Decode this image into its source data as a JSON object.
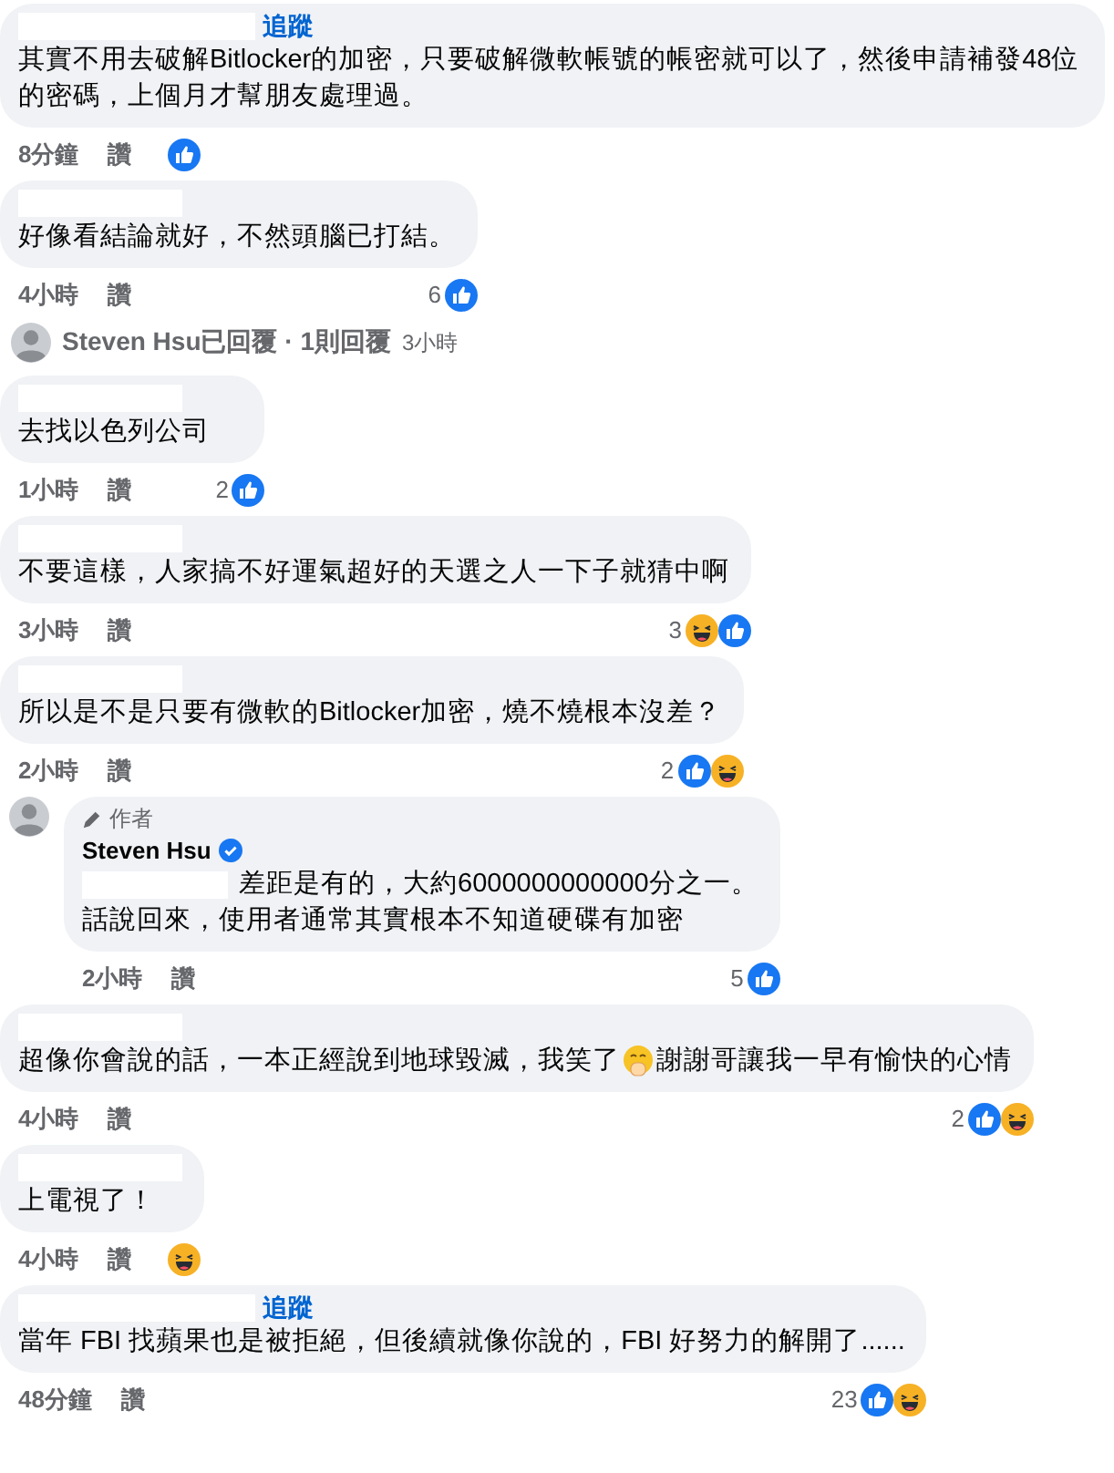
{
  "comments": [
    {
      "kind": "comment",
      "follow": "追蹤",
      "text": [
        "其實不用去破解Bitlocker的加密，只要破解微軟帳號的帳密就可以了，然後申請補發48位的密碼，上個月才幫朋友處理過。"
      ],
      "time": "8分鐘",
      "like_label": "讚",
      "reactions": [
        {
          "kind": "like"
        }
      ]
    },
    {
      "kind": "comment",
      "text": [
        "好像看結論就好，不然頭腦已打結。"
      ],
      "time": "4小時",
      "like_label": "讚",
      "count": "6",
      "reactions": [
        {
          "kind": "like"
        }
      ]
    },
    {
      "kind": "reply_summary",
      "label": "Steven Hsu已回覆 · 1則回覆",
      "time": "3小時"
    },
    {
      "kind": "comment",
      "text": [
        "去找以色列公司"
      ],
      "time": "1小時",
      "like_label": "讚",
      "count": "2",
      "reactions": [
        {
          "kind": "like"
        }
      ]
    },
    {
      "kind": "comment",
      "text": [
        "不要這樣，人家搞不好運氣超好的天選之人一下子就猜中啊"
      ],
      "time": "3小時",
      "like_label": "讚",
      "count": "3",
      "reactions": [
        {
          "kind": "haha"
        },
        {
          "kind": "like"
        }
      ]
    },
    {
      "kind": "comment",
      "text": [
        "所以是不是只要有微軟的Bitlocker加密，燒不燒根本沒差？"
      ],
      "time": "2小時",
      "like_label": "讚",
      "count": "2",
      "reactions": [
        {
          "kind": "like"
        },
        {
          "kind": "haha"
        }
      ]
    },
    {
      "kind": "reply",
      "badge": "作者",
      "name": "Steven Hsu",
      "verified": true,
      "mention": true,
      "text": [
        "差距是有的，大約6000000000000分之一。",
        "話說回來，使用者通常其實根本不知道硬碟有加密"
      ],
      "time": "2小時",
      "like_label": "讚",
      "count": "5",
      "reactions": [
        {
          "kind": "like"
        }
      ]
    },
    {
      "kind": "comment",
      "text": [
        "超像你會說的話，一本正經說到地球毀滅，我笑了",
        "謝謝哥讓我一早有愉快的心情"
      ],
      "inline_emoji": true,
      "time": "4小時",
      "like_label": "讚",
      "count": "2",
      "reactions": [
        {
          "kind": "like"
        },
        {
          "kind": "haha"
        }
      ]
    },
    {
      "kind": "comment",
      "text": [
        "上電視了！"
      ],
      "time": "4小時",
      "like_label": "讚",
      "reactions": [
        {
          "kind": "haha"
        }
      ]
    },
    {
      "kind": "comment",
      "follow": "追蹤",
      "text": [
        "當年 FBI 找蘋果也是被拒絕，但後續就像你說的，FBI 好努力的解開了......"
      ],
      "time": "48分鐘",
      "like_label": "讚",
      "count": "23",
      "reactions": [
        {
          "kind": "like"
        },
        {
          "kind": "haha"
        }
      ]
    }
  ]
}
